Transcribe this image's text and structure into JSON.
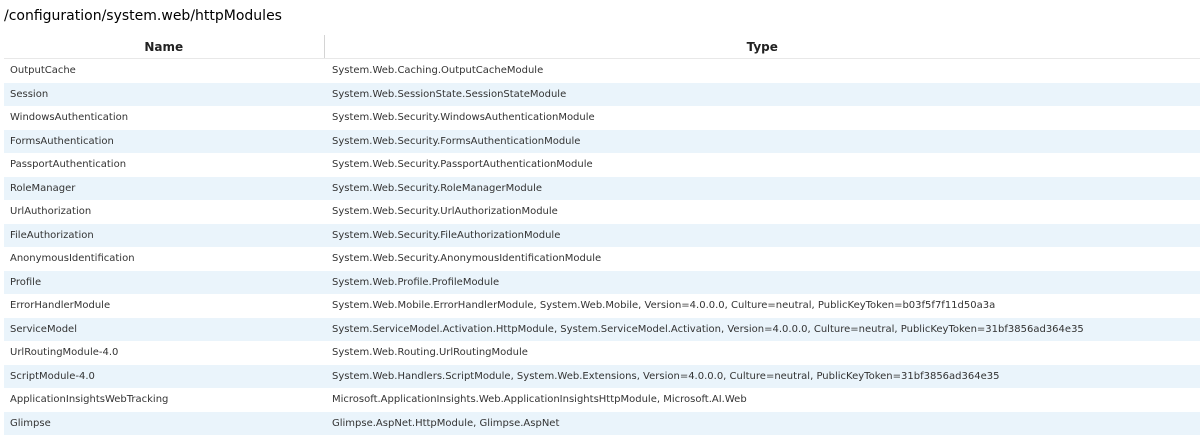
{
  "page": {
    "title": "/configuration/system.web/httpModules"
  },
  "table": {
    "columns": {
      "name": "Name",
      "type": "Type"
    },
    "rows": [
      {
        "name": "OutputCache",
        "type": "System.Web.Caching.OutputCacheModule"
      },
      {
        "name": "Session",
        "type": "System.Web.SessionState.SessionStateModule"
      },
      {
        "name": "WindowsAuthentication",
        "type": "System.Web.Security.WindowsAuthenticationModule"
      },
      {
        "name": "FormsAuthentication",
        "type": "System.Web.Security.FormsAuthenticationModule"
      },
      {
        "name": "PassportAuthentication",
        "type": "System.Web.Security.PassportAuthenticationModule"
      },
      {
        "name": "RoleManager",
        "type": "System.Web.Security.RoleManagerModule"
      },
      {
        "name": "UrlAuthorization",
        "type": "System.Web.Security.UrlAuthorizationModule"
      },
      {
        "name": "FileAuthorization",
        "type": "System.Web.Security.FileAuthorizationModule"
      },
      {
        "name": "AnonymousIdentification",
        "type": "System.Web.Security.AnonymousIdentificationModule"
      },
      {
        "name": "Profile",
        "type": "System.Web.Profile.ProfileModule"
      },
      {
        "name": "ErrorHandlerModule",
        "type": "System.Web.Mobile.ErrorHandlerModule, System.Web.Mobile, Version=4.0.0.0, Culture=neutral, PublicKeyToken=b03f5f7f11d50a3a"
      },
      {
        "name": "ServiceModel",
        "type": "System.ServiceModel.Activation.HttpModule, System.ServiceModel.Activation, Version=4.0.0.0, Culture=neutral, PublicKeyToken=31bf3856ad364e35"
      },
      {
        "name": "UrlRoutingModule-4.0",
        "type": "System.Web.Routing.UrlRoutingModule"
      },
      {
        "name": "ScriptModule-4.0",
        "type": "System.Web.Handlers.ScriptModule, System.Web.Extensions, Version=4.0.0.0, Culture=neutral, PublicKeyToken=31bf3856ad364e35"
      },
      {
        "name": "ApplicationInsightsWebTracking",
        "type": "Microsoft.ApplicationInsights.Web.ApplicationInsightsHttpModule, Microsoft.AI.Web"
      },
      {
        "name": "Glimpse",
        "type": "Glimpse.AspNet.HttpModule, Glimpse.AspNet"
      }
    ]
  },
  "colors": {
    "row_alt": "#eaf4fb",
    "text": "#333333",
    "header_divider": "#d4d4d4"
  }
}
